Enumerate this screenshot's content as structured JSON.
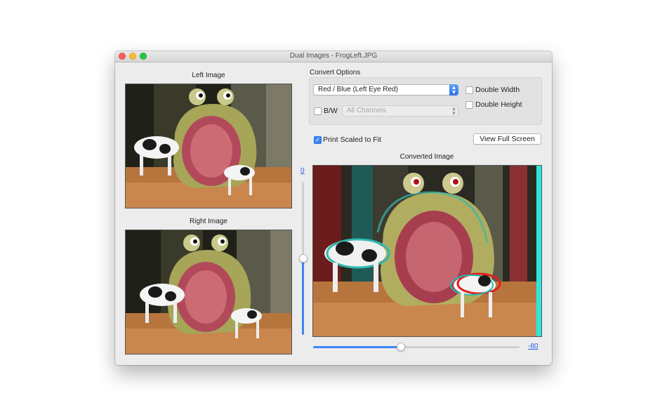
{
  "window": {
    "title": "Dual Images - FrogLeft.JPG"
  },
  "left_panel": {
    "left_image_label": "Left Image",
    "right_image_label": "Right Image"
  },
  "convert_options": {
    "group_label": "Convert Options",
    "mode_popup": {
      "selected": "Red / Blue (Left Eye Red)"
    },
    "bw_checkbox": {
      "label": "B/W",
      "checked": false
    },
    "channels_popup": {
      "selected": "All Channels",
      "enabled": false
    },
    "double_width": {
      "label": "Double Width",
      "checked": false
    },
    "double_height": {
      "label": "Double Height",
      "checked": false
    }
  },
  "print_scaled": {
    "label": "Print Scaled to Fit",
    "checked": true
  },
  "view_full_screen_label": "View Full Screen",
  "converted_image_label": "Converted Image",
  "vertical_offset": {
    "value": "0",
    "level_fraction": 0.5
  },
  "horizontal_offset": {
    "value": "-80",
    "level_fraction": 0.43
  },
  "colors": {
    "accent": "#3d86f6",
    "link": "#2a5ee8"
  },
  "icons": {
    "close": "close-traffic-light-icon",
    "minimize": "minimize-traffic-light-icon",
    "zoom": "zoom-traffic-light-icon",
    "popup_arrows": "up-down-chevron-icon",
    "checkmark": "checkmark-icon"
  }
}
